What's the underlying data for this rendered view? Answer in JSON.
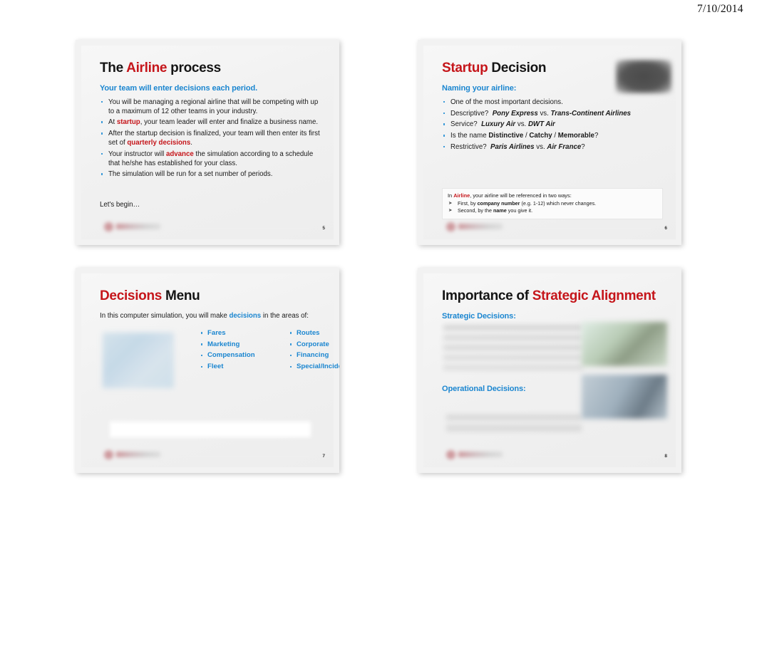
{
  "page": {
    "date": "7/10/2014"
  },
  "slides": [
    {
      "number": "5",
      "title": {
        "part1": "The ",
        "accent": "Airline",
        "part2": " process"
      },
      "subtitle": "Your team will enter decisions each period.",
      "bullets": [
        "You will be managing a regional airline that will be competing with up to a maximum of 12 other teams in your industry.",
        "At startup, your team leader will enter and finalize a business name.",
        "After the startup decision is finalized, your team will then enter its first set of quarterly decisions.",
        "Your instructor will advance the simulation according to a schedule that he/she has established for your class.",
        "The simulation will be run for a set number of periods."
      ],
      "closing": "Let's begin…"
    },
    {
      "number": "6",
      "title": {
        "accent": "Startup",
        "part2": " Decision"
      },
      "subtitle": "Naming your airline:",
      "bullets": [
        "One of the most important decisions.",
        "Descriptive?  Pony Express vs. Trans-Continent Airlines",
        "Service?  Luxury Air vs. DWT Air",
        "Is the name Distinctive / Catchy / Memorable?",
        "Restrictive?  Paris Airlines vs. Air France?"
      ],
      "callout": {
        "lead_pre": "In ",
        "lead_accent": "Airline",
        "lead_post": ", your airline will be referenced in two ways:",
        "items": [
          {
            "pre": "First, by ",
            "bold": "company number",
            "post": " (e.g. 1-12) which never changes."
          },
          {
            "pre": "Second, by the ",
            "bold": "name",
            "post": " you give it."
          }
        ]
      }
    },
    {
      "number": "7",
      "title": {
        "accent": "Decisions",
        "part2": " Menu"
      },
      "intro": {
        "pre": "In this computer simulation, you will make ",
        "link": "decisions",
        "post": " in the areas of:"
      },
      "menu_columns": [
        [
          "Fares",
          "Marketing",
          "Compensation",
          "Fleet"
        ],
        [
          "Routes",
          "Corporate",
          "Financing",
          "Special/Incidents"
        ]
      ]
    },
    {
      "number": "8",
      "title": {
        "part1": "Importance of ",
        "accent": "Strategic Alignment"
      },
      "labels": {
        "strategic": "Strategic Decisions:",
        "operational": "Operational Decisions:"
      }
    }
  ]
}
